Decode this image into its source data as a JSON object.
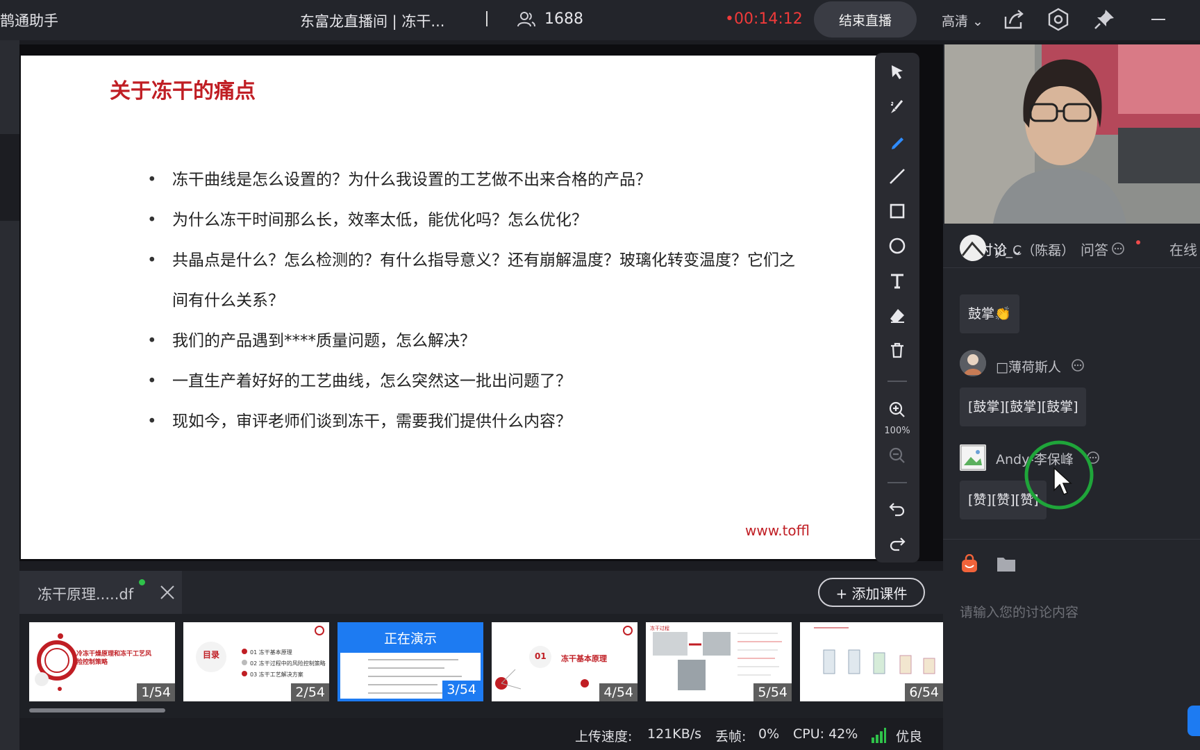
{
  "window": {
    "app_name": "鹊通助手",
    "room_title": "东富龙直播间 | 冻干...",
    "viewer_count": "1688",
    "live_timer": "•00:14:12",
    "end_button": "结束直播",
    "quality": "高清 ⌄"
  },
  "slide": {
    "title": "关于冻干的痛点",
    "bullets": [
      "冻干曲线是怎么设置的？为什么我设置的工艺做不出来合格的产品？",
      "为什么冻干时间那么长，效率太低，能优化吗？怎么优化？",
      "共晶点是什么？怎么检测的？有什么指导意义？还有崩解温度？玻璃化转变温度？它们之间有什么关系？",
      "我们的产品遇到****质量问题，怎么解决？",
      "一直生产着好好的工艺曲线，怎么突然这一批出问题了？",
      "现如今，审评老师们谈到冻干，需要我们提供什么内容？"
    ],
    "url": "www.toffl"
  },
  "toolbar": {
    "zoom_level": "100%"
  },
  "document": {
    "tab_name": "冻干原理.....df",
    "add_course": "+ 添加课件",
    "presenting_label": "正在演示",
    "thumbnails": [
      {
        "page": "1/54",
        "title": "冷冻干燥原理和冻干工艺风险控制策略"
      },
      {
        "page": "2/54",
        "title": "目录"
      },
      {
        "page": "3/54",
        "title": ""
      },
      {
        "page": "4/54",
        "title": "冻干基本原理"
      },
      {
        "page": "5/54",
        "title": "冻干过程"
      },
      {
        "page": "6/54",
        "title": ""
      }
    ],
    "thumb2_items": [
      "01 冻干基本原理",
      "02 冻干过程中的风险控制策略",
      "03 冻干工艺解决方案"
    ],
    "thumb4_num": "01"
  },
  "status": {
    "upload_label": "上传速度:",
    "upload_value": "121KB/s",
    "drop_label": "丢帧:",
    "drop_value": "0%",
    "cpu": "CPU: 42%",
    "network": "优良"
  },
  "panel": {
    "tabs": [
      "讨论 ⌄",
      "问答",
      "在线"
    ],
    "messages": [
      {
        "user": "yi_C（陈磊）",
        "text": "鼓掌👏"
      },
      {
        "user": "□薄荷斯人",
        "text": "[鼓掌][鼓掌][鼓掌]"
      },
      {
        "user": "Andy-李保峰",
        "text": "[赞][赞][赞]"
      }
    ],
    "input_placeholder": "请输入您的讨论内容"
  },
  "colors": {
    "accent_blue": "#1d7bf2",
    "live_red": "#f03a3a",
    "slide_red": "#c01e24",
    "cursor_ring": "#1fa53a"
  }
}
